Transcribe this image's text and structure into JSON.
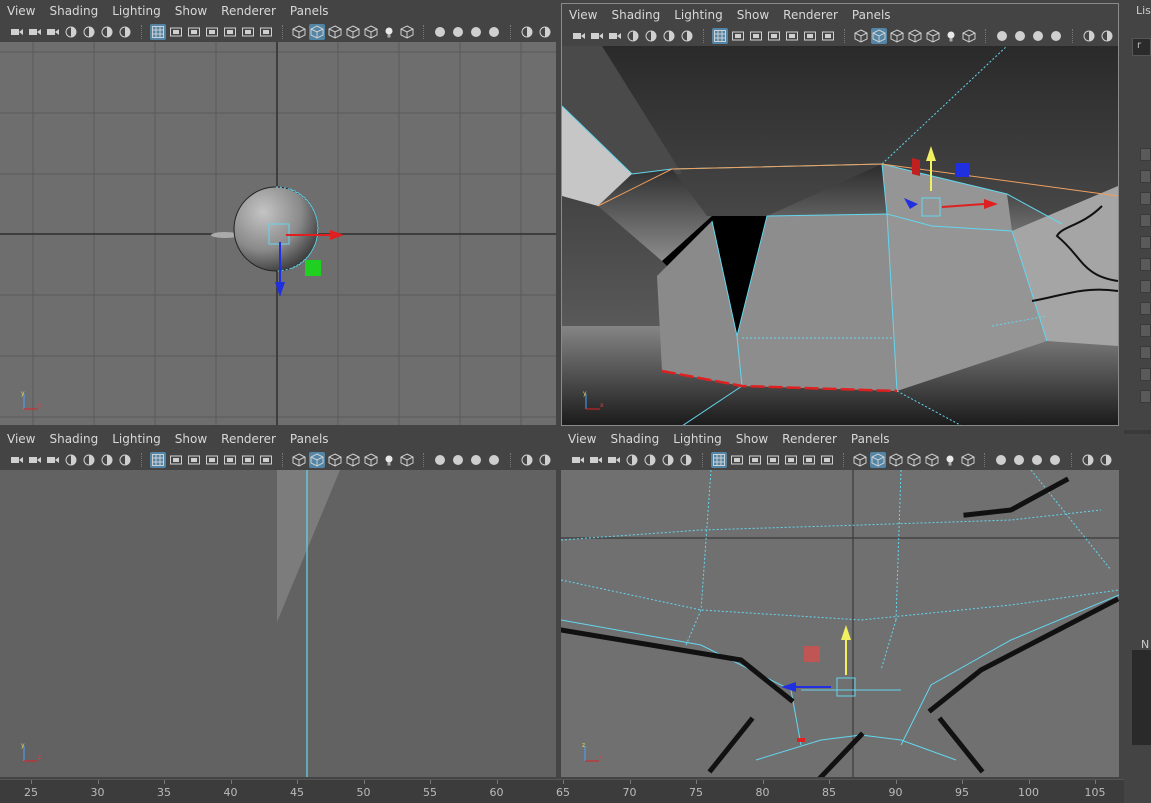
{
  "menus": [
    "View",
    "Shading",
    "Lighting",
    "Show",
    "Renderer",
    "Panels"
  ],
  "toolbar_icons": [
    [
      "camera-select-icon",
      "camera-lock-icon",
      "camera-attributes-icon",
      "bookmark-icon",
      "image-plane-icon",
      "two-d-pan-icon",
      "grease-pencil-icon"
    ],
    [
      "grid-icon",
      "film-gate-icon",
      "resolution-gate-icon",
      "gate-mask-icon",
      "field-chart-icon",
      "safe-action-icon",
      "safe-title-icon"
    ],
    [
      "wireframe-icon",
      "smooth-shade-icon",
      "use-default-material-icon",
      "wireframe-on-shaded-icon",
      "textured-icon",
      "use-all-lights-icon",
      "shadows-icon"
    ],
    [
      "screen-space-ao-icon",
      "motion-blur-icon",
      "anti-aliasing-icon",
      "depth-of-field-icon"
    ],
    [
      "isolate-select-icon",
      "xray-icon"
    ]
  ],
  "right_panel": {
    "title_fragment": "Lis",
    "input_fragment": "r",
    "section_fragment": "N"
  },
  "timeline": {
    "ticks": [
      "25",
      "30",
      "35",
      "40",
      "45",
      "50",
      "55",
      "60",
      "65",
      "70",
      "75",
      "80",
      "85",
      "90",
      "95",
      "100",
      "105"
    ]
  },
  "colors": {
    "wire_cyan": "#63d6ee",
    "axis_x": "#e02020",
    "axis_y": "#f0f080",
    "axis_z": "#2030e0",
    "accent": "#5285a6"
  }
}
